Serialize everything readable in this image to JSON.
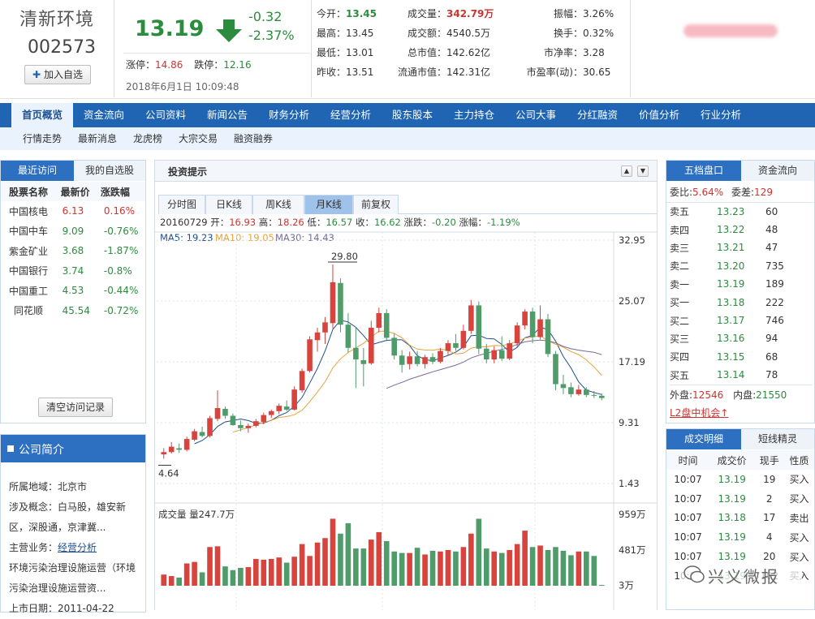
{
  "stock": {
    "name": "清新环境",
    "code": "002573",
    "add_watch": "加入自选",
    "price": "13.19",
    "change": "-0.32",
    "change_pct": "-2.37%",
    "limit_up_label": "涨停：",
    "limit_up": "14.86",
    "limit_down_label": "跌停：",
    "limit_down": "12.16",
    "datetime": "2018年6月1日  10:09:48"
  },
  "quote": {
    "rows": [
      [
        {
          "l": "今开：",
          "v": "13.45",
          "c": "dn"
        },
        {
          "l": "成交量：",
          "v": "342.79万",
          "c": "up"
        },
        {
          "l": "振幅：",
          "v": "3.26%",
          "c": ""
        }
      ],
      [
        {
          "l": "最高：",
          "v": "13.45",
          "c": ""
        },
        {
          "l": "成交额：",
          "v": "4540.5万",
          "c": ""
        },
        {
          "l": "换手：",
          "v": "0.32%",
          "c": ""
        }
      ],
      [
        {
          "l": "最低：",
          "v": "13.01",
          "c": ""
        },
        {
          "l": "总市值：",
          "v": "142.62亿",
          "c": ""
        },
        {
          "l": "市净率：",
          "v": "3.28",
          "c": ""
        }
      ],
      [
        {
          "l": "昨收：",
          "v": "13.51",
          "c": ""
        },
        {
          "l": "流通市值：",
          "v": "142.31亿",
          "c": ""
        },
        {
          "l": "市盈率(动)：",
          "v": "30.65",
          "c": ""
        }
      ]
    ]
  },
  "nav": {
    "items": [
      "首页概览",
      "资金流向",
      "公司资料",
      "新闻公告",
      "财务分析",
      "经营分析",
      "股东股本",
      "主力持仓",
      "公司大事",
      "分红融资",
      "价值分析",
      "行业分析"
    ],
    "sub": [
      "行情走势",
      "最新消息",
      "龙虎榜",
      "大宗交易",
      "融资融券"
    ]
  },
  "left": {
    "tab_recent": "最近访问",
    "tab_watch": "我的自选股",
    "headers": [
      "股票名称",
      "最新价",
      "涨跌幅"
    ],
    "rows": [
      [
        "中国核电",
        "6.13",
        "0.16%",
        "up"
      ],
      [
        "中国中车",
        "9.09",
        "-0.76%",
        "dn"
      ],
      [
        "紫金矿业",
        "3.68",
        "-1.87%",
        "dn"
      ],
      [
        "中国银行",
        "3.74",
        "-0.8%",
        "dn"
      ],
      [
        "中国重工",
        "4.53",
        "-0.44%",
        "dn"
      ],
      [
        "同花顺",
        "45.54",
        "-0.72%",
        "dn"
      ]
    ],
    "clear_btn": "清空访问记录",
    "profile_title": "公司简介",
    "profile": {
      "region_label": "所属地域：",
      "region": "北京市",
      "concept_label": "涉及概念：",
      "concept_1": "白马股，雄安新",
      "concept_2": "区，深股通，京津冀...",
      "business_label": "主营业务：",
      "business_link": "经营分析",
      "business_1": "环境污染治理设施运营（环境",
      "business_2": "污染治理设施运营资...",
      "list_label": "上市日期：",
      "list_date": "2011-04-22"
    }
  },
  "center": {
    "title": "投资提示",
    "tabs": [
      "分时图",
      "日K线",
      "周K线",
      "月K线",
      "前复权"
    ],
    "info": {
      "date": "20160729",
      "o_l": "开：",
      "o": "16.93",
      "h_l": "高：",
      "h": "18.26",
      "l_l": "低：",
      "l": "16.57",
      "c_l": "收：",
      "c": "16.62",
      "ch_l": "涨跌：",
      "ch": "-0.20",
      "pct_l": "涨幅：",
      "pct": "-1.19%"
    },
    "ma": {
      "ma5": "MA5: 19.23",
      "ma10": "MA10: 19.05",
      "ma30": "MA30: 14.43"
    },
    "vol_label": "成交量",
    "vol_value": "量247.7万"
  },
  "right": {
    "tab_book": "五档盘口",
    "tab_flow": "资金流向",
    "wb_label": "委比:",
    "wb": "5.64%",
    "wc_label": "委差:",
    "wc": "129",
    "book": [
      [
        "卖五",
        "13.23",
        "60"
      ],
      [
        "卖四",
        "13.22",
        "48"
      ],
      [
        "卖三",
        "13.21",
        "47"
      ],
      [
        "卖二",
        "13.20",
        "735"
      ],
      [
        "卖一",
        "13.19",
        "189"
      ],
      [
        "买一",
        "13.18",
        "222"
      ],
      [
        "买二",
        "13.17",
        "746"
      ],
      [
        "买三",
        "13.16",
        "94"
      ],
      [
        "买四",
        "13.15",
        "68"
      ],
      [
        "买五",
        "13.14",
        "78"
      ]
    ],
    "outer_label": "外盘:",
    "outer": "12546",
    "inner_label": "内盘:",
    "inner": "21550",
    "l2": "L2盘中机会↑",
    "tab_detail": "成交明细",
    "tab_short": "短线精灵",
    "detail_headers": [
      "时间",
      "成交价",
      "现手",
      "性质"
    ],
    "detail": [
      [
        "10:07",
        "13.19",
        "19",
        "买入"
      ],
      [
        "10:07",
        "13.19",
        "2",
        "买入"
      ],
      [
        "10:07",
        "13.18",
        "17",
        "卖出"
      ],
      [
        "10:07",
        "13.19",
        "4",
        "买入"
      ],
      [
        "10:07",
        "13.19",
        "20",
        "买入"
      ],
      [
        "10:07",
        "13.19",
        "102",
        "买入"
      ]
    ],
    "watermark": "兴义微报"
  },
  "chart_data": {
    "type": "candlestick",
    "title": "月K线",
    "y_ticks": [
      "32.95",
      "25.07",
      "17.19",
      "9.31",
      "1.43"
    ],
    "ylim": [
      1.43,
      32.95
    ],
    "max_label": "29.80",
    "min_label": "4.64",
    "vol_ticks": [
      "959万",
      "481万",
      "3万"
    ],
    "vol_max": 959,
    "candles": [
      [
        5.2,
        6.0,
        4.64,
        5.5
      ],
      [
        5.5,
        6.8,
        5.3,
        6.2
      ],
      [
        6.0,
        6.6,
        5.4,
        5.8
      ],
      [
        5.8,
        7.5,
        5.6,
        7.2
      ],
      [
        7.1,
        8.5,
        6.9,
        8.2
      ],
      [
        8.1,
        8.8,
        7.4,
        7.6
      ],
      [
        7.6,
        10.2,
        7.4,
        9.9
      ],
      [
        9.8,
        13.5,
        9.5,
        11.2
      ],
      [
        11.1,
        11.4,
        9.8,
        10.2
      ],
      [
        10.2,
        10.5,
        8.9,
        9.0
      ],
      [
        9.0,
        9.6,
        8.2,
        8.6
      ],
      [
        8.6,
        9.2,
        8.0,
        8.9
      ],
      [
        8.9,
        9.8,
        8.7,
        9.5
      ],
      [
        9.4,
        10.6,
        9.1,
        10.3
      ],
      [
        10.3,
        11.0,
        9.9,
        10.8
      ],
      [
        10.8,
        11.8,
        10.4,
        11.5
      ],
      [
        11.4,
        12.2,
        10.8,
        11.0
      ],
      [
        11.0,
        14.0,
        10.9,
        13.6
      ],
      [
        13.5,
        16.3,
        13.2,
        16.0
      ],
      [
        16.0,
        20.5,
        15.8,
        20.1
      ],
      [
        20.0,
        21.6,
        18.5,
        21.0
      ],
      [
        21.0,
        23.0,
        19.5,
        22.3
      ],
      [
        22.2,
        29.8,
        21.5,
        27.5
      ],
      [
        27.4,
        28.0,
        21.0,
        22.0
      ],
      [
        22.0,
        23.5,
        18.4,
        19.0
      ],
      [
        19.0,
        21.6,
        13.8,
        17.5
      ],
      [
        17.4,
        19.0,
        14.0,
        16.9
      ],
      [
        17.0,
        22.5,
        16.8,
        21.6
      ],
      [
        21.6,
        24.2,
        21.0,
        23.5
      ],
      [
        23.5,
        24.0,
        20.0,
        20.3
      ],
      [
        20.3,
        20.9,
        17.5,
        18.0
      ],
      [
        18.0,
        18.7,
        15.8,
        16.8
      ],
      [
        16.9,
        18.5,
        16.2,
        17.9
      ],
      [
        17.9,
        18.6,
        16.6,
        16.9
      ],
      [
        16.9,
        18.1,
        16.3,
        17.8
      ],
      [
        17.8,
        18.3,
        16.9,
        17.2
      ],
      [
        17.2,
        19.0,
        17.0,
        18.6
      ],
      [
        18.6,
        20.0,
        18.0,
        19.6
      ],
      [
        19.6,
        20.8,
        18.6,
        19.0
      ],
      [
        19.0,
        22.0,
        18.8,
        21.2
      ],
      [
        21.2,
        25.2,
        20.8,
        24.5
      ],
      [
        24.5,
        25.0,
        18.2,
        18.9
      ],
      [
        18.9,
        19.5,
        17.0,
        17.5
      ],
      [
        17.5,
        19.2,
        17.0,
        18.7
      ],
      [
        18.7,
        20.5,
        17.3,
        17.6
      ],
      [
        17.6,
        20.0,
        17.4,
        19.6
      ],
      [
        19.6,
        22.3,
        19.1,
        21.9
      ],
      [
        21.9,
        24.0,
        21.4,
        23.7
      ],
      [
        23.7,
        24.2,
        19.6,
        20.4
      ],
      [
        20.4,
        24.5,
        20.1,
        22.7
      ],
      [
        22.7,
        23.4,
        17.8,
        18.2
      ],
      [
        18.2,
        18.6,
        13.5,
        14.3
      ],
      [
        14.3,
        15.5,
        13.0,
        13.8
      ],
      [
        13.9,
        14.5,
        12.6,
        13.0
      ],
      [
        13.0,
        14.2,
        12.8,
        13.6
      ],
      [
        13.6,
        13.9,
        12.6,
        12.9
      ],
      [
        12.9,
        13.4,
        12.5,
        12.8
      ],
      [
        12.8,
        13.1,
        12.2,
        12.5
      ]
    ],
    "volumes": [
      150,
      130,
      110,
      300,
      320,
      180,
      520,
      530,
      260,
      210,
      240,
      250,
      360,
      350,
      360,
      380,
      310,
      390,
      560,
      400,
      580,
      640,
      900,
      700,
      840,
      500,
      500,
      620,
      720,
      600,
      460,
      440,
      440,
      510,
      420,
      470,
      460,
      480,
      460,
      520,
      700,
      900,
      500,
      460,
      440,
      480,
      560,
      740,
      520,
      540,
      480,
      520,
      470,
      410,
      460,
      460,
      400,
      10
    ]
  }
}
